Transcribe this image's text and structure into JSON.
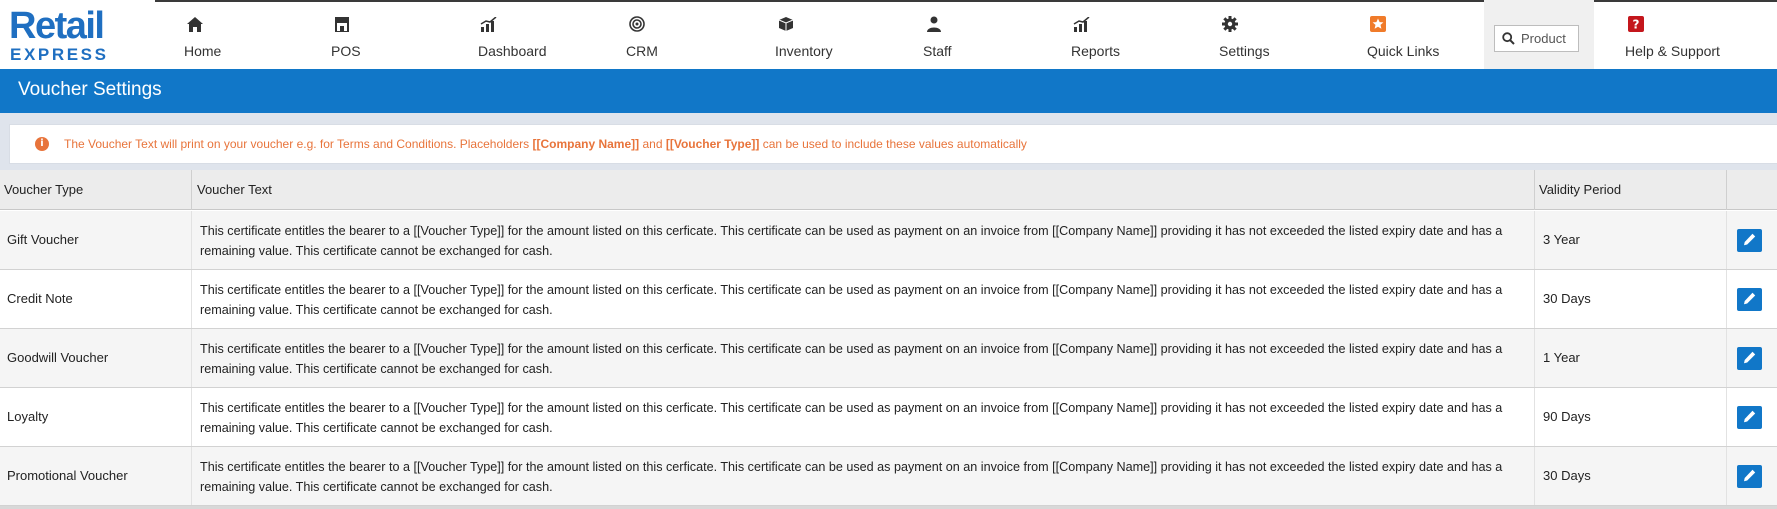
{
  "logo": {
    "line1": "Retail",
    "line2": "EXPRESS",
    "color": "#1f6fc1"
  },
  "nav": [
    {
      "label": "Home",
      "icon": "home-icon"
    },
    {
      "label": "POS",
      "icon": "store-icon"
    },
    {
      "label": "Dashboard",
      "icon": "bar-chart-icon"
    },
    {
      "label": "CRM",
      "icon": "target-icon"
    },
    {
      "label": "Inventory",
      "icon": "cube-icon"
    },
    {
      "label": "Staff",
      "icon": "user-icon"
    },
    {
      "label": "Reports",
      "icon": "bar-chart-icon"
    },
    {
      "label": "Settings",
      "icon": "gear-icon"
    },
    {
      "label": "Quick Links",
      "icon": "star-icon"
    },
    {
      "label": "Help & Support",
      "icon": "help-icon"
    }
  ],
  "search": {
    "placeholder": "Product"
  },
  "page": {
    "title": "Voucher Settings"
  },
  "info": {
    "part1": "The Voucher Text will print on your voucher e.g. for Terms and Conditions. Placeholders ",
    "placeholder1": "[[Company Name]]",
    "part2": " and ",
    "placeholder2": "[[Voucher Type]]",
    "part3": " can be used to include these values automatically"
  },
  "table": {
    "headers": {
      "type": "Voucher Type",
      "text": "Voucher Text",
      "validity": "Validity Period"
    },
    "rows": [
      {
        "type": "Gift Voucher",
        "text": "This certificate entitles the bearer to a [[Voucher Type]] for the amount listed on this cerficate. This certificate can be used as payment on an invoice from [[Company Name]] providing it has not exceeded the listed expiry date and has a remaining value. This certificate cannot be exchanged for cash.",
        "validity": "3 Year"
      },
      {
        "type": "Credit Note",
        "text": "This certificate entitles the bearer to a [[Voucher Type]] for the amount listed on this cerficate. This certificate can be used as payment on an invoice from [[Company Name]] providing it has not exceeded the listed expiry date and has a remaining value. This certificate cannot be exchanged for cash.",
        "validity": "30 Days"
      },
      {
        "type": "Goodwill Voucher",
        "text": "This certificate entitles the bearer to a [[Voucher Type]] for the amount listed on this cerficate. This certificate can be used as payment on an invoice from [[Company Name]] providing it has not exceeded the listed expiry date and has a remaining value. This certificate cannot be exchanged for cash.",
        "validity": "1 Year"
      },
      {
        "type": "Loyalty",
        "text": "This certificate entitles the bearer to a [[Voucher Type]] for the amount listed on this cerficate. This certificate can be used as payment on an invoice from [[Company Name]] providing it has not exceeded the listed expiry date and has a remaining value. This certificate cannot be exchanged for cash.",
        "validity": "90 Days"
      },
      {
        "type": "Promotional Voucher",
        "text": "This certificate entitles the bearer to a [[Voucher Type]] for the amount listed on this cerficate. This certificate can be used as payment on an invoice from [[Company Name]] providing it has not exceeded the listed expiry date and has a remaining value. This certificate cannot be exchanged for cash.",
        "validity": "30 Days"
      }
    ],
    "row_action_icon": "pencil-icon"
  },
  "colors": {
    "brand_blue": "#1177c8",
    "info_orange": "#e8743b",
    "quicklinks_orange": "#f07b2a",
    "help_red": "#c4161c"
  }
}
